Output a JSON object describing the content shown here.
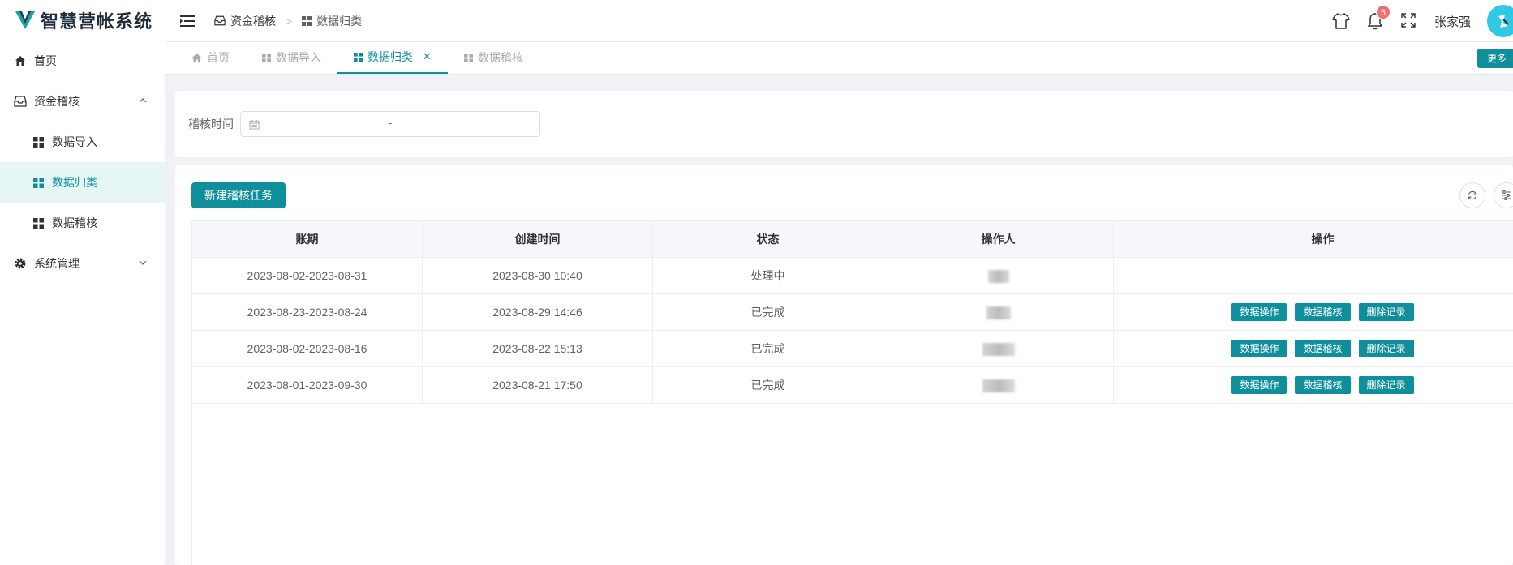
{
  "app": {
    "title": "智慧营帐系统"
  },
  "sidebar": {
    "items": [
      {
        "label": "首页",
        "icon": "home-icon"
      },
      {
        "label": "资金稽核",
        "icon": "inbox-icon",
        "expanded": true
      },
      {
        "label": "数据导入",
        "icon": "grid-icon"
      },
      {
        "label": "数据归类",
        "icon": "grid-icon",
        "active": true
      },
      {
        "label": "数据稽核",
        "icon": "grid-icon"
      },
      {
        "label": "系统管理",
        "icon": "gear-icon",
        "expanded": false
      }
    ]
  },
  "header": {
    "breadcrumb": [
      "资金稽核",
      "数据归类"
    ],
    "notification_count": "5",
    "username": "张家强"
  },
  "tabs": [
    {
      "label": "首页"
    },
    {
      "label": "数据导入"
    },
    {
      "label": "数据归类",
      "active": true
    },
    {
      "label": "数据稽核"
    }
  ],
  "more_label": "更多",
  "search": {
    "label": "稽核时间",
    "range_separator": "-"
  },
  "toolbar": {
    "new_task_label": "新建稽核任务"
  },
  "table": {
    "columns": [
      "账期",
      "创建时间",
      "状态",
      "操作人",
      "操作"
    ],
    "rows": [
      {
        "period": "2023-08-02-2023-08-31",
        "created": "2023-08-30 10:40",
        "status": "处理中",
        "has_actions": false
      },
      {
        "period": "2023-08-23-2023-08-24",
        "created": "2023-08-29 14:46",
        "status": "已完成",
        "has_actions": true
      },
      {
        "period": "2023-08-02-2023-08-16",
        "created": "2023-08-22 15:13",
        "status": "已完成",
        "has_actions": true
      },
      {
        "period": "2023-08-01-2023-09-30",
        "created": "2023-08-21 17:50",
        "status": "已完成",
        "has_actions": true
      }
    ],
    "actions": [
      "数据操作",
      "数据稽核",
      "删除记录"
    ]
  },
  "colors": {
    "primary": "#0f8e9c",
    "badge": "#f56c6c",
    "avatar": "#2ec9e4"
  }
}
